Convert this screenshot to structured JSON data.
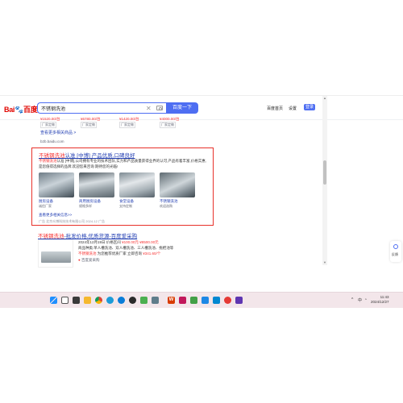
{
  "search": {
    "query": "不锈钢洗池",
    "button": "百度一下"
  },
  "header": {
    "logo": "Bai",
    "logo_suffix": "百度",
    "links": [
      "百度首页",
      "设置"
    ],
    "login": "登录"
  },
  "prev_result": {
    "prices": [
      "¥1520.00/台",
      "¥6780.00/台",
      "¥1420.00/台",
      "¥4000.00/台"
    ],
    "tags": [
      "厂家定做",
      "厂家定做",
      "厂家定做",
      "厂家定做"
    ],
    "more": "查看更多相关商品 >",
    "url": "b2b.baidu.com"
  },
  "ad": {
    "title_red": "不锈钢洗池",
    "title_rest": "认准 [中博] 产品优质,口碑良好",
    "desc_red": "不锈钢洗池",
    "desc": "认准 [中博],公司拥有专业的技术团队,实力和产品质量获得业界的认可,产品有着丰富,价格实惠,是您值得选择的品牌,欢迎您来咨询 期待您的光临!",
    "thumbs": [
      {
        "label": "厨房设备",
        "sub": "诚信厂家"
      },
      {
        "label": "商用厨房设备",
        "sub": "规格多样"
      },
      {
        "label": "食堂设备",
        "sub": "支持定制"
      },
      {
        "label": "不锈钢洗池",
        "sub": "欢迎选购"
      }
    ],
    "more": "查看更多相关信息>>",
    "meta": "广告  北京众博科技技术有限公司  2024-12  广告"
  },
  "result2": {
    "title_red": "不锈钢洗池",
    "title_rest": "-批发价格,优质货源-百度爱采购",
    "line1_label": "2024年12月19日",
    "line1_mid": "价格区间",
    "line1_price": "¥100.00元-¥8500.00元",
    "line2": "商品种类:单人槽洗池、双人槽洗池、三人槽洗池、拖把池等",
    "line3_red": "不锈钢洗池",
    "line3": "为您推荐优质厂家 立即咨询",
    "line3_price": "¥341.60/个",
    "source": "百度爱采购"
  },
  "side_widget": {
    "label": "反馈"
  },
  "taskbar": {
    "clock_time": "11:43",
    "clock_date": "2024/12/27",
    "tray_lang": "中"
  },
  "colors": {
    "accent": "#4e6ef2",
    "link": "#2440b3",
    "highlight": "#f73131",
    "taskbar": "#f3e6ea"
  }
}
